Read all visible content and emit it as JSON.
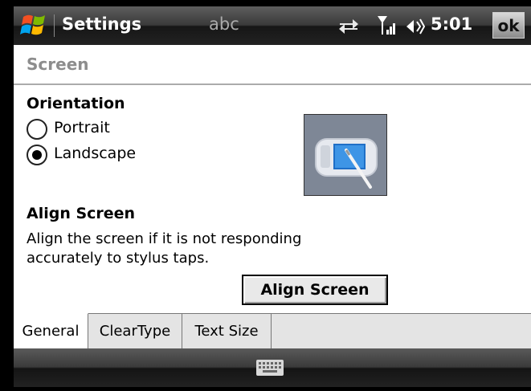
{
  "titlebar": {
    "title": "Settings",
    "input_mode": "abc",
    "clock": "5:01",
    "ok_label": "ok",
    "icons": [
      "windows-start-icon",
      "sync-icon",
      "signal-icon",
      "volume-icon"
    ]
  },
  "header": {
    "title": "Screen"
  },
  "orientation": {
    "heading": "Orientation",
    "options": [
      {
        "label": "Portrait",
        "selected": false
      },
      {
        "label": "Landscape",
        "selected": true
      }
    ]
  },
  "align": {
    "heading": "Align Screen",
    "description": "Align the screen if it is not responding accurately to stylus taps.",
    "button_label": "Align Screen"
  },
  "tabs": [
    {
      "label": "General",
      "active": true
    },
    {
      "label": "ClearType",
      "active": false
    },
    {
      "label": "Text Size",
      "active": false
    }
  ],
  "softbar": {
    "icon": "keyboard-icon"
  },
  "colors": {
    "title_text": "#ffffff",
    "header_text": "#8d8d8d",
    "screen_bg": "#ffffff",
    "tab_bg": "#e4e4e4"
  }
}
